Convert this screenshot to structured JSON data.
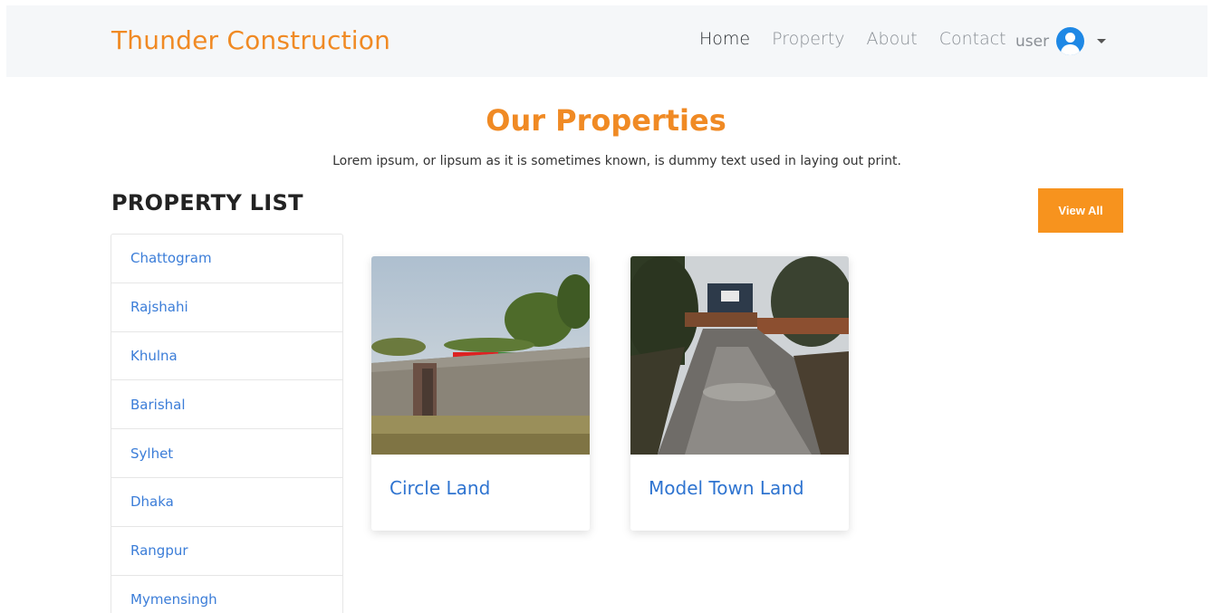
{
  "navbar": {
    "brand": "Thunder Construction",
    "links": [
      "Home",
      "Property",
      "About",
      "Contact"
    ],
    "user_label": "user",
    "user_icon": "user-circle-icon",
    "dropdown_icon": "caret-down-icon",
    "brand_color": "#f08a24"
  },
  "section": {
    "title": "Our Properties",
    "subtitle": "Lorem ipsum, or lipsum as it is sometimes known, is dummy text used in laying out print."
  },
  "property_list": {
    "title": "PROPERTY LIST",
    "items": [
      "Chattogram",
      "Rajshahi",
      "Khulna",
      "Barishal",
      "Sylhet",
      "Dhaka",
      "Rangpur",
      "Mymensingh"
    ]
  },
  "view_all_label": "View All",
  "cards": [
    {
      "title": "Circle Land"
    },
    {
      "title": "Model Town Land"
    }
  ],
  "colors": {
    "accent": "#f7931e",
    "link": "#3b7dd8"
  }
}
